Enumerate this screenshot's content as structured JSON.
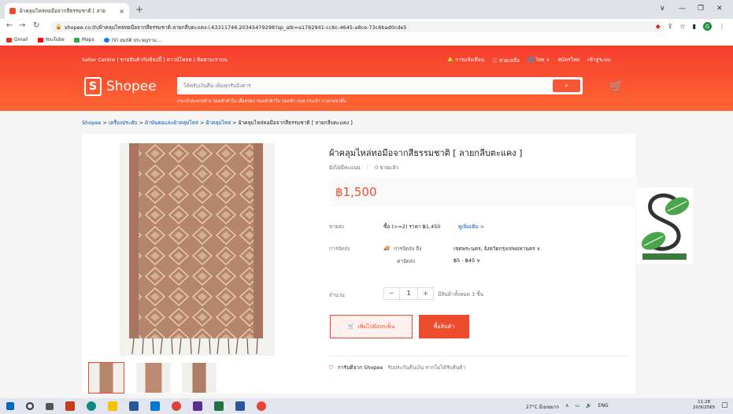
{
  "browser": {
    "tab_title": "ผ้าคลุมไหล่ทอมือจากสีธรรมชาติ [ ลาย",
    "tab_close": "×",
    "new_tab": "+",
    "url": "shopee.co.th/ผ้าคลุมไหล่ทอมือจากสีธรรมชาติ-ลายกลีบตะแคง-i.63311746.20345479298?sp_atk=a1762941-cc6c-4645-a8ce-73c6bad0cde5",
    "bookmarks": [
      {
        "label": "Gmail",
        "color": "#d93025"
      },
      {
        "label": "YouTube",
        "color": "#ff0000"
      },
      {
        "label": "Maps",
        "color": "#34a853"
      },
      {
        "label": "(9) สมบัติ ประจญราม...",
        "color": "#1877f2"
      }
    ],
    "profile_initial": "G"
  },
  "header": {
    "top_left": "Seller Centre | ขายสินค้ากับช้อปปี้ | ดาวน์โหลด | ติดตามเราบน",
    "notifications": "การแจ้งเตือน",
    "help": "ช่วยเหลือ",
    "language": "ไทย",
    "signup": "สมัครใหม่",
    "login": "เข้าสู่ระบบ",
    "logo_text": "Shopee",
    "search_placeholder": "โค้ดรับเงินคืน เพิ่มทุกรับอังคาร",
    "suggestions": "กระเป๋าสะพายข้าง   รองเท้าผ้าใบ   เสื้อครอป   รองเท้าผ้าใบ   รองเท้า   แมส   กระเป๋า   กางเกงขาสั้น"
  },
  "breadcrumb": {
    "items": [
      "Shopee",
      "เครื่องประดับ",
      "ผ้าพันคอและผ้าคลุมไหล่",
      "ผ้าคลุมไหล่"
    ],
    "current": "ผ้าคลุมไหล่ทอมือจากสีธรรมชาติ [ ลายกลีบตะแคง ]"
  },
  "product": {
    "title": "ผ้าคลุมไหล่ทอมือจากสีธรรมชาติ [ ลายกลีบตะแคง ]",
    "rating_text": "ยังไม่มีคะแนน",
    "sold": "0 ขายแล้ว",
    "price": "฿1,500",
    "wholesale_label": "ขายส่ง",
    "wholesale_value": "ซื้อ (>=2) ราคา ฿1,450",
    "wholesale_more": "ดูเพิ่มเติม >",
    "shipping_label": "การจัดส่ง",
    "shipping_to": "การจัดส่ง ถึง",
    "shipping_location": "เขตพระนคร, จังหวัดกรุงเทพมหานคร ∨",
    "shipping_cost_label": "ค่าจัดส่ง",
    "shipping_cost": "฿5 - ฿45 ∨",
    "quantity_label": "จำนวน",
    "quantity": "1",
    "minus": "−",
    "plus": "+",
    "stock": "มีสินค้าทั้งหมด 3 ชิ้น",
    "add_to_cart": "เพิ่มไปยังรถเข็น",
    "buy_now": "ซื้อสินค้า",
    "guarantee_title": "การันตีจาก Shopee",
    "guarantee_text": "รับประกันคืนเงิน หากไม่ได้รับสินค้า"
  },
  "taskbar": {
    "weather": "27°C มีเมฆมาก",
    "lang": "ENG",
    "time": "11:28",
    "date": "20/9/2565"
  },
  "colors": {
    "brand": "#ee4d2d",
    "header_start": "#f53d2d",
    "header_end": "#ff6633"
  }
}
